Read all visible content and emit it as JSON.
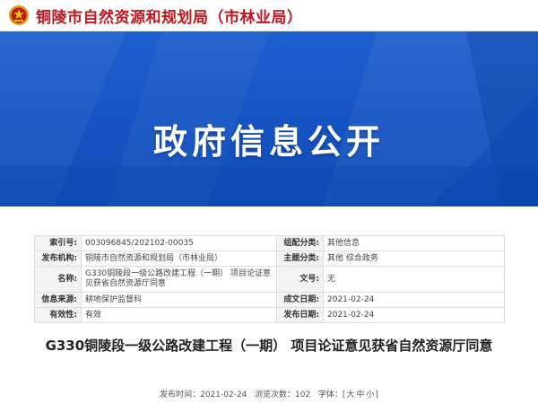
{
  "header": {
    "site_name": "铜陵市自然资源和规划局（市林业局）",
    "emblem_icon": "national-emblem-icon",
    "brand_color": "#c0161c"
  },
  "banner": {
    "title": "政府信息公开",
    "background_color": "#1655c4"
  },
  "info_table": {
    "rows": [
      {
        "label1": "索引号:",
        "value1": "003096845/202102-00035",
        "label2": "组配分类:",
        "value2": "其他信息"
      },
      {
        "label1": "发布机构:",
        "value1": "铜陵市自然资源和规划局（市林业局）",
        "label2": "主题分类:",
        "value2": "其他  综合政务"
      },
      {
        "label1": "名称:",
        "value1": "G330铜陵段一级公路改建工程（一期）  项目论证意见获省自然资源厅同意",
        "label2": "文号:",
        "value2": "无"
      },
      {
        "label1": "信息来源:",
        "value1": "耕地保护监督科",
        "label2": "成文日期:",
        "value2": "2021-02-24"
      },
      {
        "label1": "有效性:",
        "value1": "有效",
        "label2": "发布日期:",
        "value2": "2021-02-24"
      }
    ]
  },
  "article": {
    "title": "G330铜陵段一级公路改建工程（一期）  项目论证意见获省自然资源厅同意"
  },
  "meta": {
    "publish_label": "发布时间：",
    "publish_date": "2021-02-24",
    "views_label": "浏览次数：",
    "views": "102",
    "font_label": "字体：",
    "font_open": "[",
    "font_large": "大",
    "font_medium": "中",
    "font_small": "小",
    "font_close": "]"
  }
}
